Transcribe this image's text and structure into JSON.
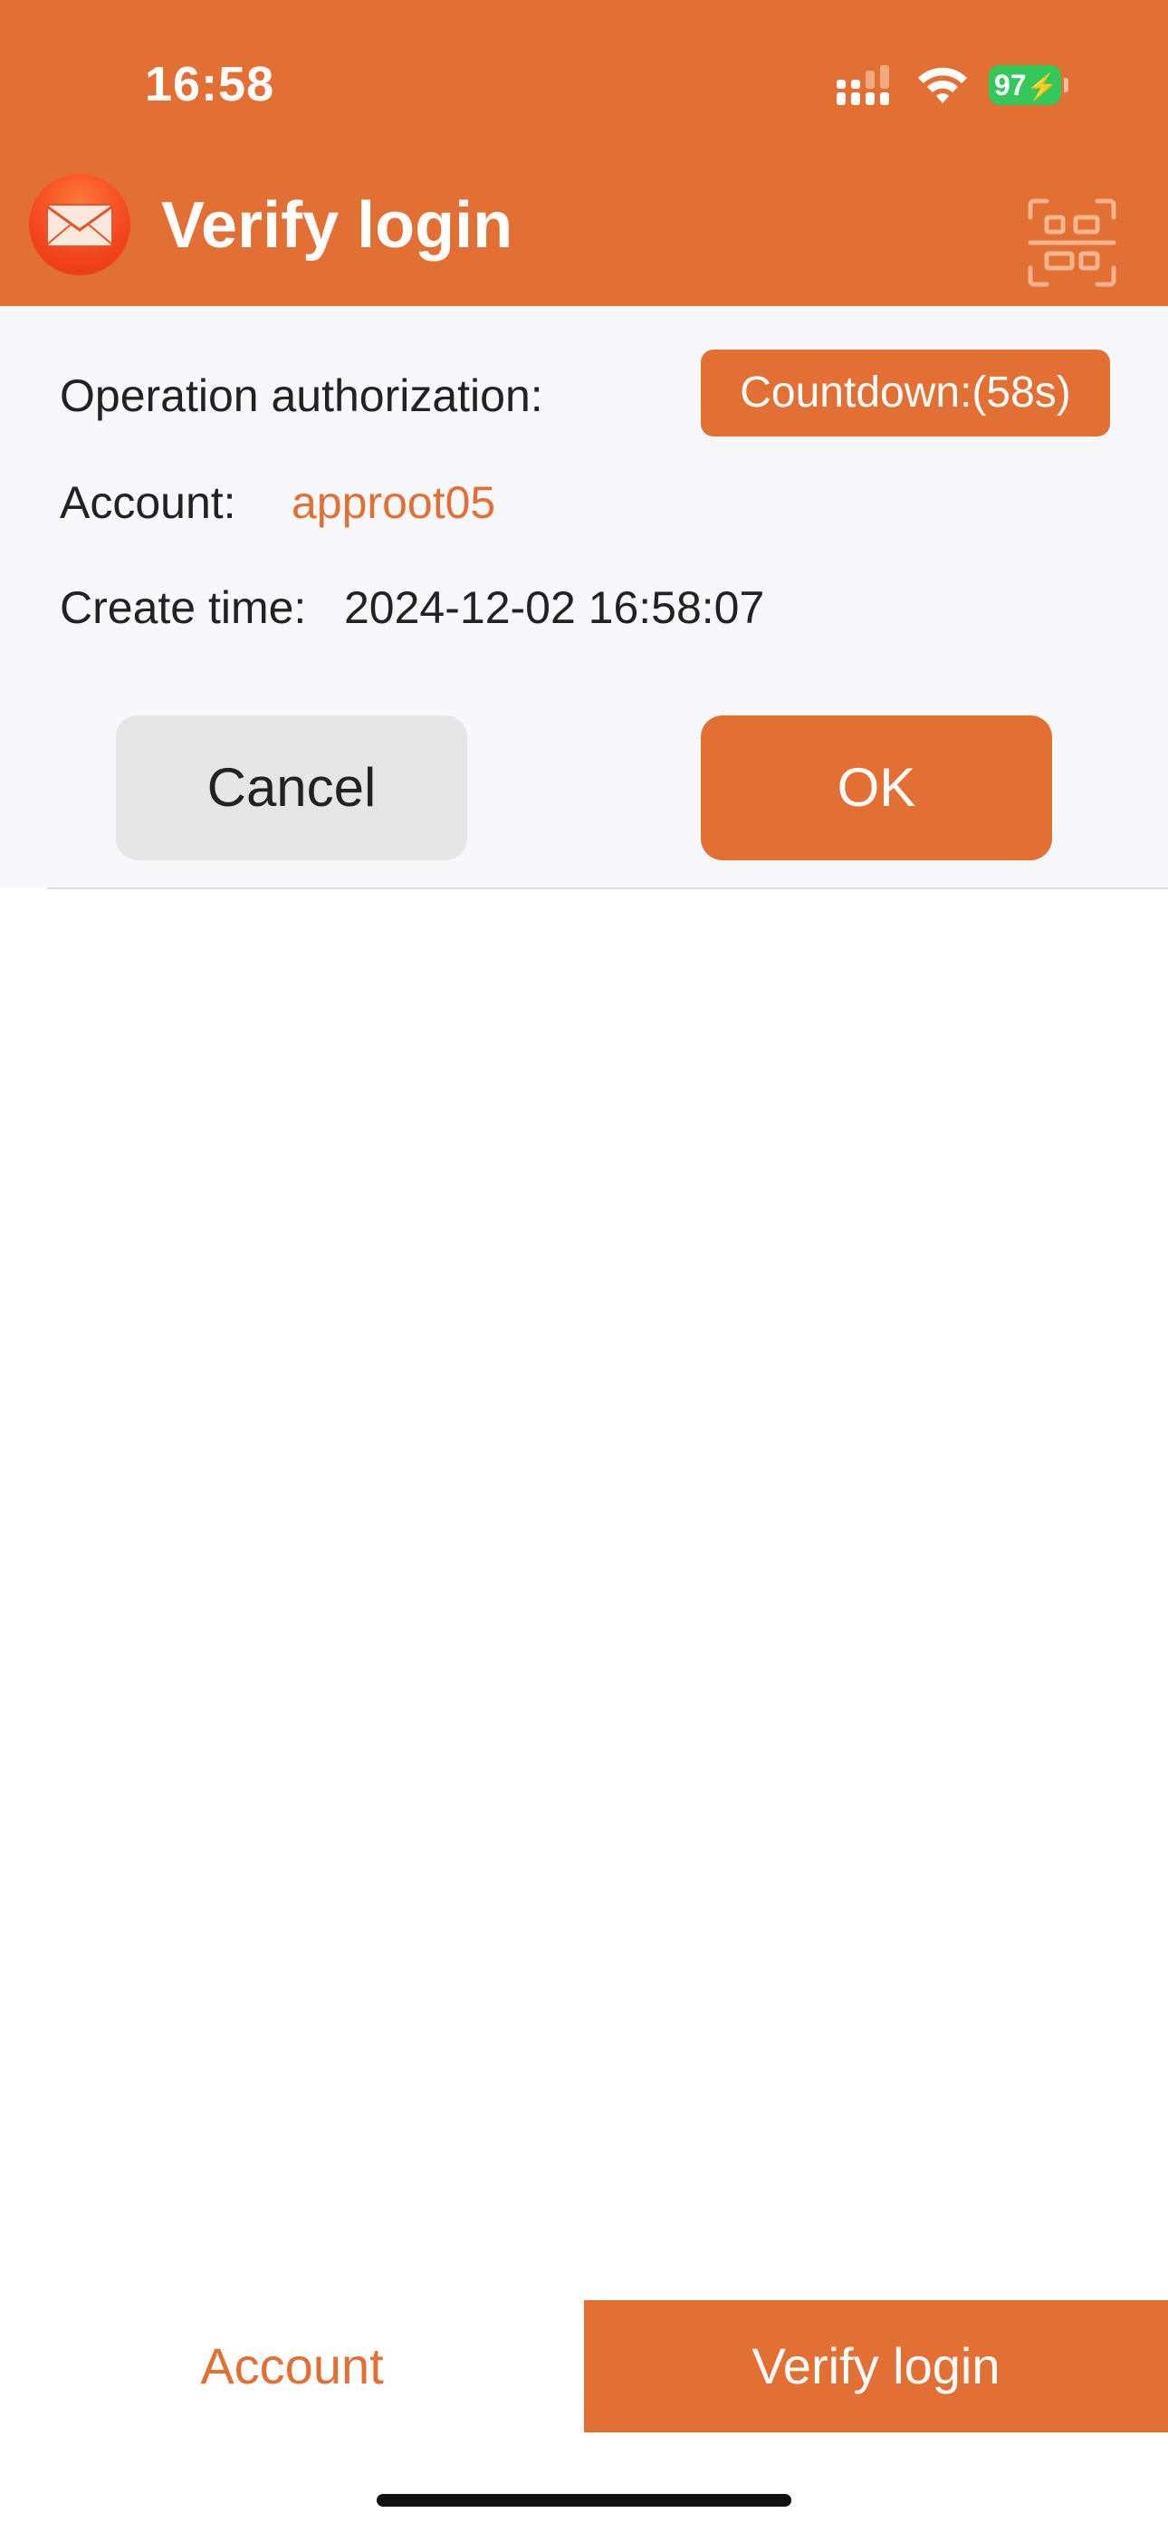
{
  "status_bar": {
    "time": "16:58",
    "battery": "97"
  },
  "header": {
    "title": "Verify login",
    "logo_icon": "mail-envelope-icon",
    "scan_icon": "qr-scan-icon"
  },
  "card": {
    "operation_label": "Operation authorization:",
    "countdown": "Countdown:(58s)",
    "account_label": "Account:",
    "account_value": "approot05",
    "create_time_label": "Create time:",
    "create_time_value": "2024-12-02 16:58:07",
    "cancel_label": "Cancel",
    "ok_label": "OK"
  },
  "tabs": [
    {
      "label": "Account",
      "active": false
    },
    {
      "label": "Verify login",
      "active": true
    }
  ],
  "colors": {
    "accent": "#e27035",
    "card_background": "#f7f8fc",
    "cancel_background": "#e6e6e6",
    "battery_green": "#34c759"
  }
}
